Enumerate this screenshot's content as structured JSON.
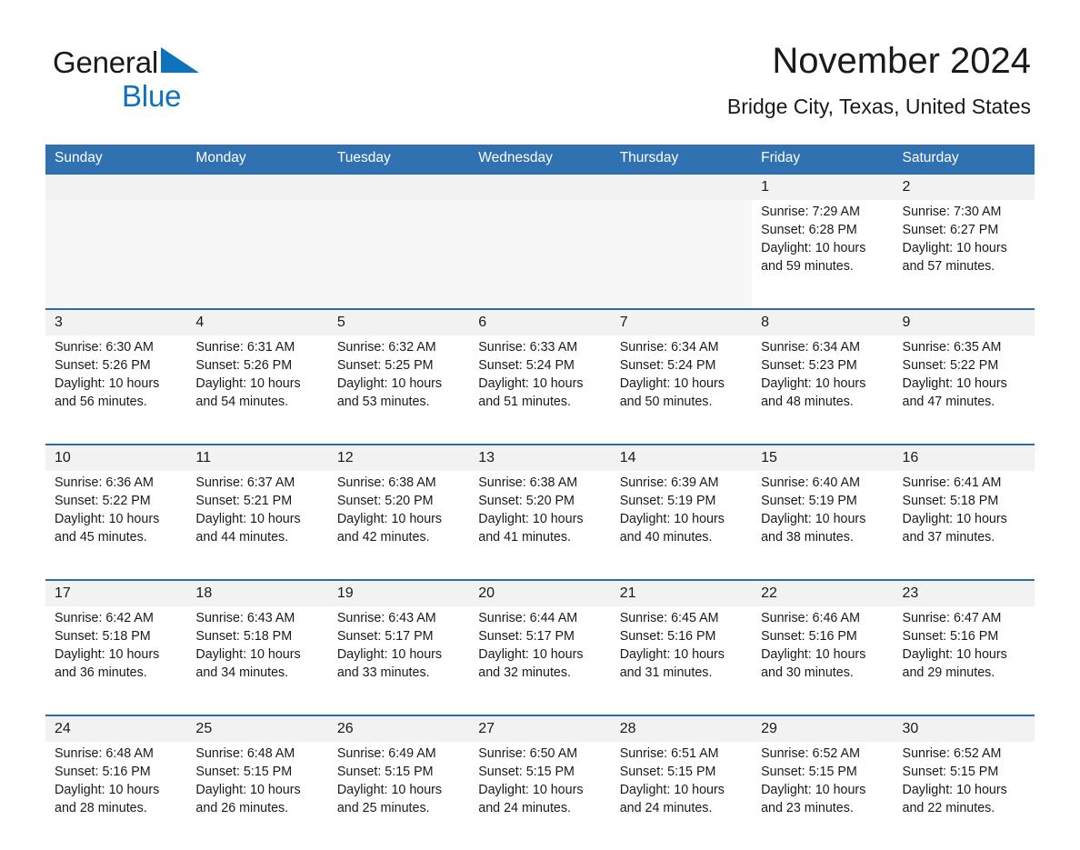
{
  "brand": {
    "line1": "General",
    "line2": "Blue",
    "triangle_icon": "triangle-icon",
    "accent_color": "#0f72bd"
  },
  "header": {
    "title": "November 2024",
    "subtitle": "Bridge City, Texas, United States",
    "header_bg_color": "#3071b2",
    "row_rule_color": "#2e6da4",
    "daynum_bg_color": "#f2f2f2"
  },
  "weekdays": [
    "Sunday",
    "Monday",
    "Tuesday",
    "Wednesday",
    "Thursday",
    "Friday",
    "Saturday"
  ],
  "weeks": [
    [
      {
        "day": "",
        "empty": true
      },
      {
        "day": "",
        "empty": true
      },
      {
        "day": "",
        "empty": true
      },
      {
        "day": "",
        "empty": true
      },
      {
        "day": "",
        "empty": true
      },
      {
        "day": "1",
        "sunrise": "Sunrise: 7:29 AM",
        "sunset": "Sunset: 6:28 PM",
        "daylight1": "Daylight: 10 hours",
        "daylight2": "and 59 minutes."
      },
      {
        "day": "2",
        "sunrise": "Sunrise: 7:30 AM",
        "sunset": "Sunset: 6:27 PM",
        "daylight1": "Daylight: 10 hours",
        "daylight2": "and 57 minutes."
      }
    ],
    [
      {
        "day": "3",
        "sunrise": "Sunrise: 6:30 AM",
        "sunset": "Sunset: 5:26 PM",
        "daylight1": "Daylight: 10 hours",
        "daylight2": "and 56 minutes."
      },
      {
        "day": "4",
        "sunrise": "Sunrise: 6:31 AM",
        "sunset": "Sunset: 5:26 PM",
        "daylight1": "Daylight: 10 hours",
        "daylight2": "and 54 minutes."
      },
      {
        "day": "5",
        "sunrise": "Sunrise: 6:32 AM",
        "sunset": "Sunset: 5:25 PM",
        "daylight1": "Daylight: 10 hours",
        "daylight2": "and 53 minutes."
      },
      {
        "day": "6",
        "sunrise": "Sunrise: 6:33 AM",
        "sunset": "Sunset: 5:24 PM",
        "daylight1": "Daylight: 10 hours",
        "daylight2": "and 51 minutes."
      },
      {
        "day": "7",
        "sunrise": "Sunrise: 6:34 AM",
        "sunset": "Sunset: 5:24 PM",
        "daylight1": "Daylight: 10 hours",
        "daylight2": "and 50 minutes."
      },
      {
        "day": "8",
        "sunrise": "Sunrise: 6:34 AM",
        "sunset": "Sunset: 5:23 PM",
        "daylight1": "Daylight: 10 hours",
        "daylight2": "and 48 minutes."
      },
      {
        "day": "9",
        "sunrise": "Sunrise: 6:35 AM",
        "sunset": "Sunset: 5:22 PM",
        "daylight1": "Daylight: 10 hours",
        "daylight2": "and 47 minutes."
      }
    ],
    [
      {
        "day": "10",
        "sunrise": "Sunrise: 6:36 AM",
        "sunset": "Sunset: 5:22 PM",
        "daylight1": "Daylight: 10 hours",
        "daylight2": "and 45 minutes."
      },
      {
        "day": "11",
        "sunrise": "Sunrise: 6:37 AM",
        "sunset": "Sunset: 5:21 PM",
        "daylight1": "Daylight: 10 hours",
        "daylight2": "and 44 minutes."
      },
      {
        "day": "12",
        "sunrise": "Sunrise: 6:38 AM",
        "sunset": "Sunset: 5:20 PM",
        "daylight1": "Daylight: 10 hours",
        "daylight2": "and 42 minutes."
      },
      {
        "day": "13",
        "sunrise": "Sunrise: 6:38 AM",
        "sunset": "Sunset: 5:20 PM",
        "daylight1": "Daylight: 10 hours",
        "daylight2": "and 41 minutes."
      },
      {
        "day": "14",
        "sunrise": "Sunrise: 6:39 AM",
        "sunset": "Sunset: 5:19 PM",
        "daylight1": "Daylight: 10 hours",
        "daylight2": "and 40 minutes."
      },
      {
        "day": "15",
        "sunrise": "Sunrise: 6:40 AM",
        "sunset": "Sunset: 5:19 PM",
        "daylight1": "Daylight: 10 hours",
        "daylight2": "and 38 minutes."
      },
      {
        "day": "16",
        "sunrise": "Sunrise: 6:41 AM",
        "sunset": "Sunset: 5:18 PM",
        "daylight1": "Daylight: 10 hours",
        "daylight2": "and 37 minutes."
      }
    ],
    [
      {
        "day": "17",
        "sunrise": "Sunrise: 6:42 AM",
        "sunset": "Sunset: 5:18 PM",
        "daylight1": "Daylight: 10 hours",
        "daylight2": "and 36 minutes."
      },
      {
        "day": "18",
        "sunrise": "Sunrise: 6:43 AM",
        "sunset": "Sunset: 5:18 PM",
        "daylight1": "Daylight: 10 hours",
        "daylight2": "and 34 minutes."
      },
      {
        "day": "19",
        "sunrise": "Sunrise: 6:43 AM",
        "sunset": "Sunset: 5:17 PM",
        "daylight1": "Daylight: 10 hours",
        "daylight2": "and 33 minutes."
      },
      {
        "day": "20",
        "sunrise": "Sunrise: 6:44 AM",
        "sunset": "Sunset: 5:17 PM",
        "daylight1": "Daylight: 10 hours",
        "daylight2": "and 32 minutes."
      },
      {
        "day": "21",
        "sunrise": "Sunrise: 6:45 AM",
        "sunset": "Sunset: 5:16 PM",
        "daylight1": "Daylight: 10 hours",
        "daylight2": "and 31 minutes."
      },
      {
        "day": "22",
        "sunrise": "Sunrise: 6:46 AM",
        "sunset": "Sunset: 5:16 PM",
        "daylight1": "Daylight: 10 hours",
        "daylight2": "and 30 minutes."
      },
      {
        "day": "23",
        "sunrise": "Sunrise: 6:47 AM",
        "sunset": "Sunset: 5:16 PM",
        "daylight1": "Daylight: 10 hours",
        "daylight2": "and 29 minutes."
      }
    ],
    [
      {
        "day": "24",
        "sunrise": "Sunrise: 6:48 AM",
        "sunset": "Sunset: 5:16 PM",
        "daylight1": "Daylight: 10 hours",
        "daylight2": "and 28 minutes."
      },
      {
        "day": "25",
        "sunrise": "Sunrise: 6:48 AM",
        "sunset": "Sunset: 5:15 PM",
        "daylight1": "Daylight: 10 hours",
        "daylight2": "and 26 minutes."
      },
      {
        "day": "26",
        "sunrise": "Sunrise: 6:49 AM",
        "sunset": "Sunset: 5:15 PM",
        "daylight1": "Daylight: 10 hours",
        "daylight2": "and 25 minutes."
      },
      {
        "day": "27",
        "sunrise": "Sunrise: 6:50 AM",
        "sunset": "Sunset: 5:15 PM",
        "daylight1": "Daylight: 10 hours",
        "daylight2": "and 24 minutes."
      },
      {
        "day": "28",
        "sunrise": "Sunrise: 6:51 AM",
        "sunset": "Sunset: 5:15 PM",
        "daylight1": "Daylight: 10 hours",
        "daylight2": "and 24 minutes."
      },
      {
        "day": "29",
        "sunrise": "Sunrise: 6:52 AM",
        "sunset": "Sunset: 5:15 PM",
        "daylight1": "Daylight: 10 hours",
        "daylight2": "and 23 minutes."
      },
      {
        "day": "30",
        "sunrise": "Sunrise: 6:52 AM",
        "sunset": "Sunset: 5:15 PM",
        "daylight1": "Daylight: 10 hours",
        "daylight2": "and 22 minutes."
      }
    ]
  ]
}
